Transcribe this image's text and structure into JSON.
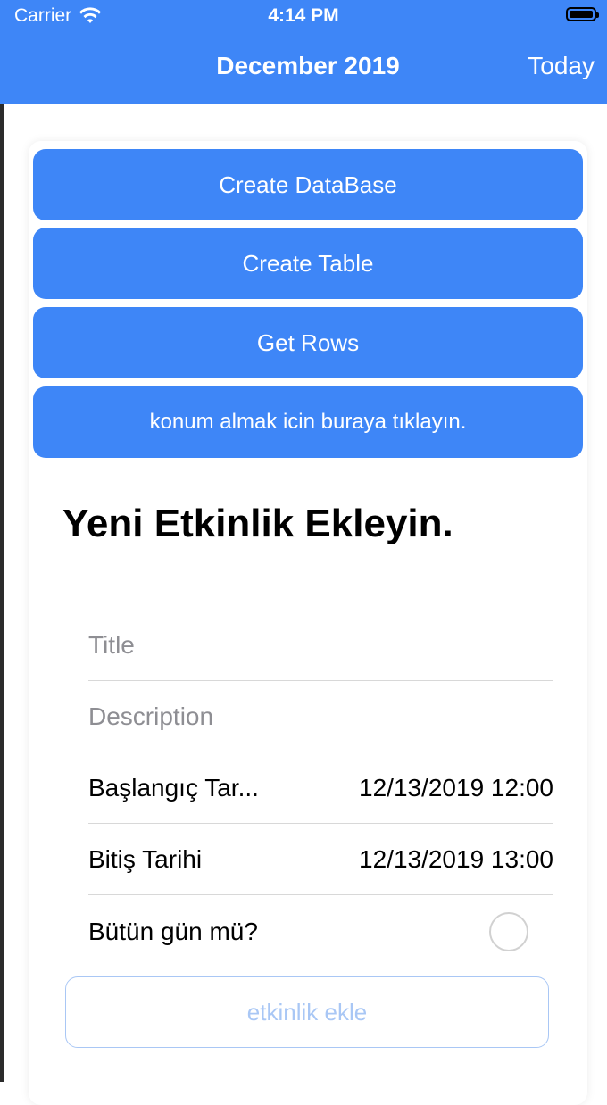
{
  "status_bar": {
    "carrier": "Carrier",
    "time": "4:14 PM"
  },
  "nav": {
    "title": "December 2019",
    "today_label": "Today"
  },
  "actions": {
    "create_database": "Create DataBase",
    "create_table": "Create Table",
    "get_rows": "Get Rows",
    "location": "konum almak icin buraya tıklayın."
  },
  "form": {
    "heading": "Yeni Etkinlik Ekleyin.",
    "title_placeholder": "Title",
    "description_placeholder": "Description",
    "start_label": "Başlangıç Tar...",
    "start_value": "12/13/2019 12:00",
    "end_label": "Bitiş Tarihi",
    "end_value": "12/13/2019 13:00",
    "all_day_label": "Bütün gün mü?",
    "all_day_checked": false,
    "submit_label": "etkinlik ekle"
  },
  "colors": {
    "accent": "#3e86f7",
    "disabled_accent": "#a9c7f5",
    "placeholder": "#8e8e93"
  }
}
